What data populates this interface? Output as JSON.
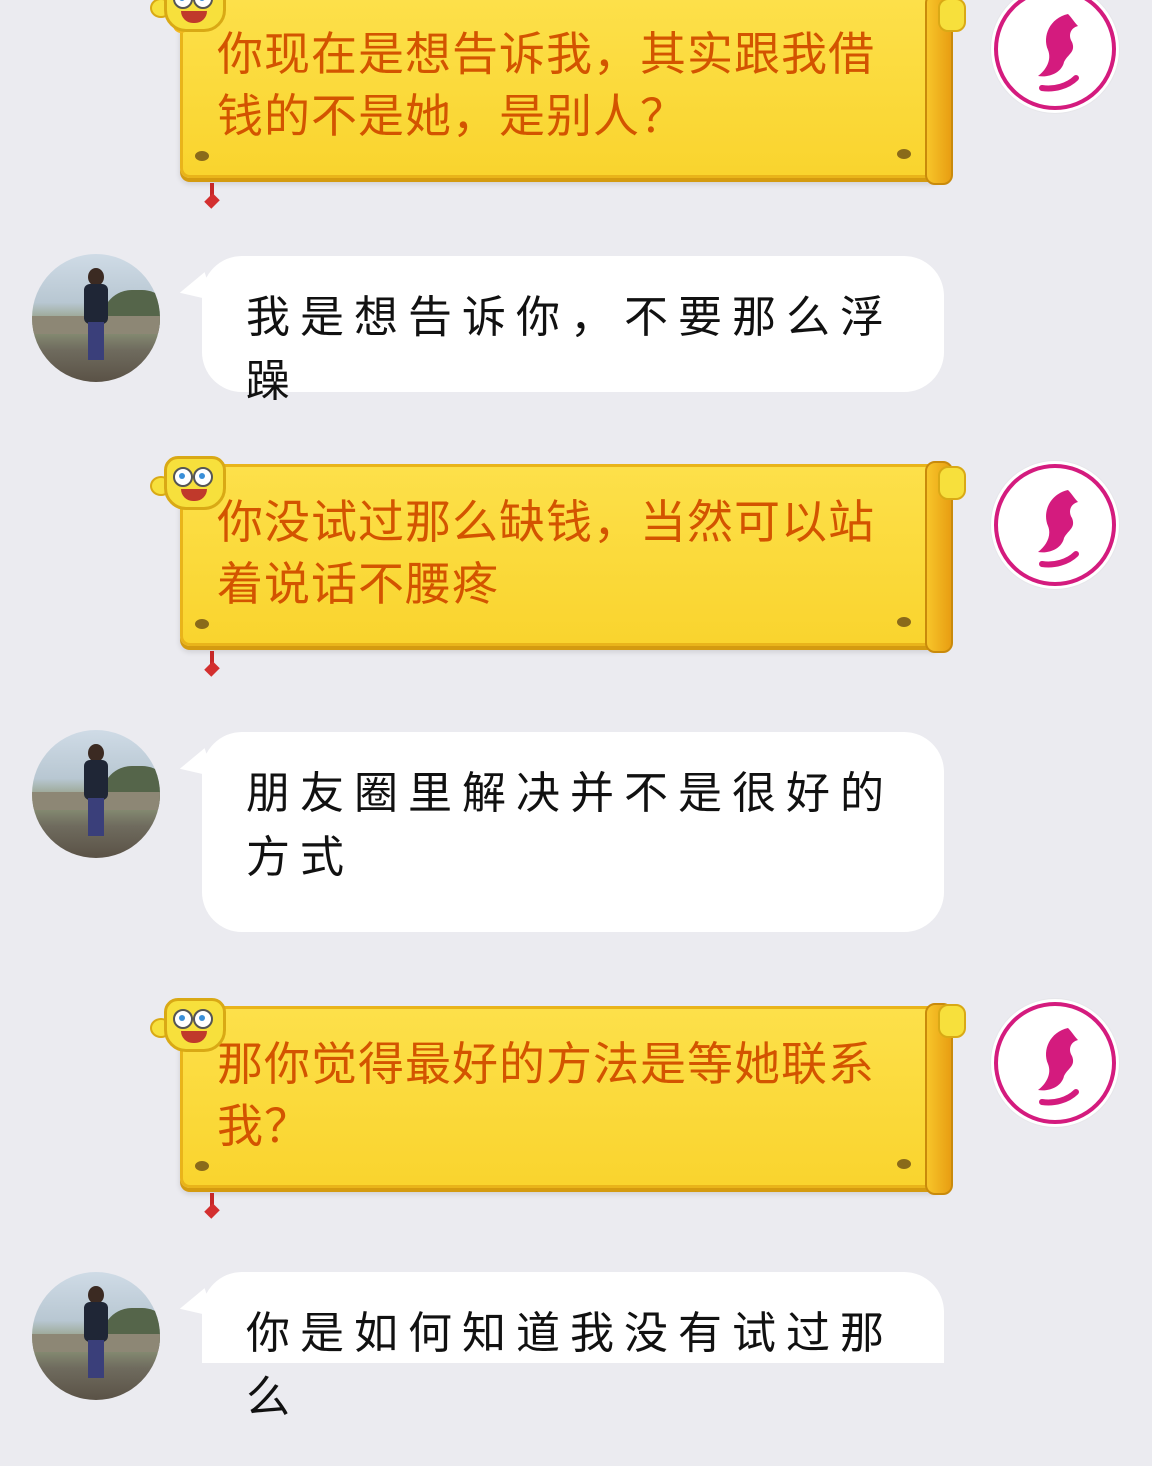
{
  "messages": [
    {
      "side": "right",
      "text": "你现在是想告诉我，其实跟我借钱的不是她，是别人？"
    },
    {
      "side": "left",
      "text": "我是想告诉你，不要那么浮躁"
    },
    {
      "side": "right",
      "text": "你没试过那么缺钱，当然可以站着说话不腰疼"
    },
    {
      "side": "left",
      "text": "朋友圈里解决并不是很好的方式"
    },
    {
      "side": "right",
      "text": "那你觉得最好的方法是等她联系我？"
    },
    {
      "side": "left",
      "text": "你是如何知道我没有试过那么"
    }
  ],
  "colors": {
    "background": "#ebebf0",
    "scroll_yellow": "#f9d42e",
    "scroll_text": "#d35400",
    "bubble_white": "#ffffff",
    "avatar_pink": "#d41b7e"
  },
  "icons": {
    "self_avatar": "pink-woman-profile-logo",
    "other_avatar": "man-standing-photo",
    "bubble_decoration": "spongebob-sticker"
  }
}
